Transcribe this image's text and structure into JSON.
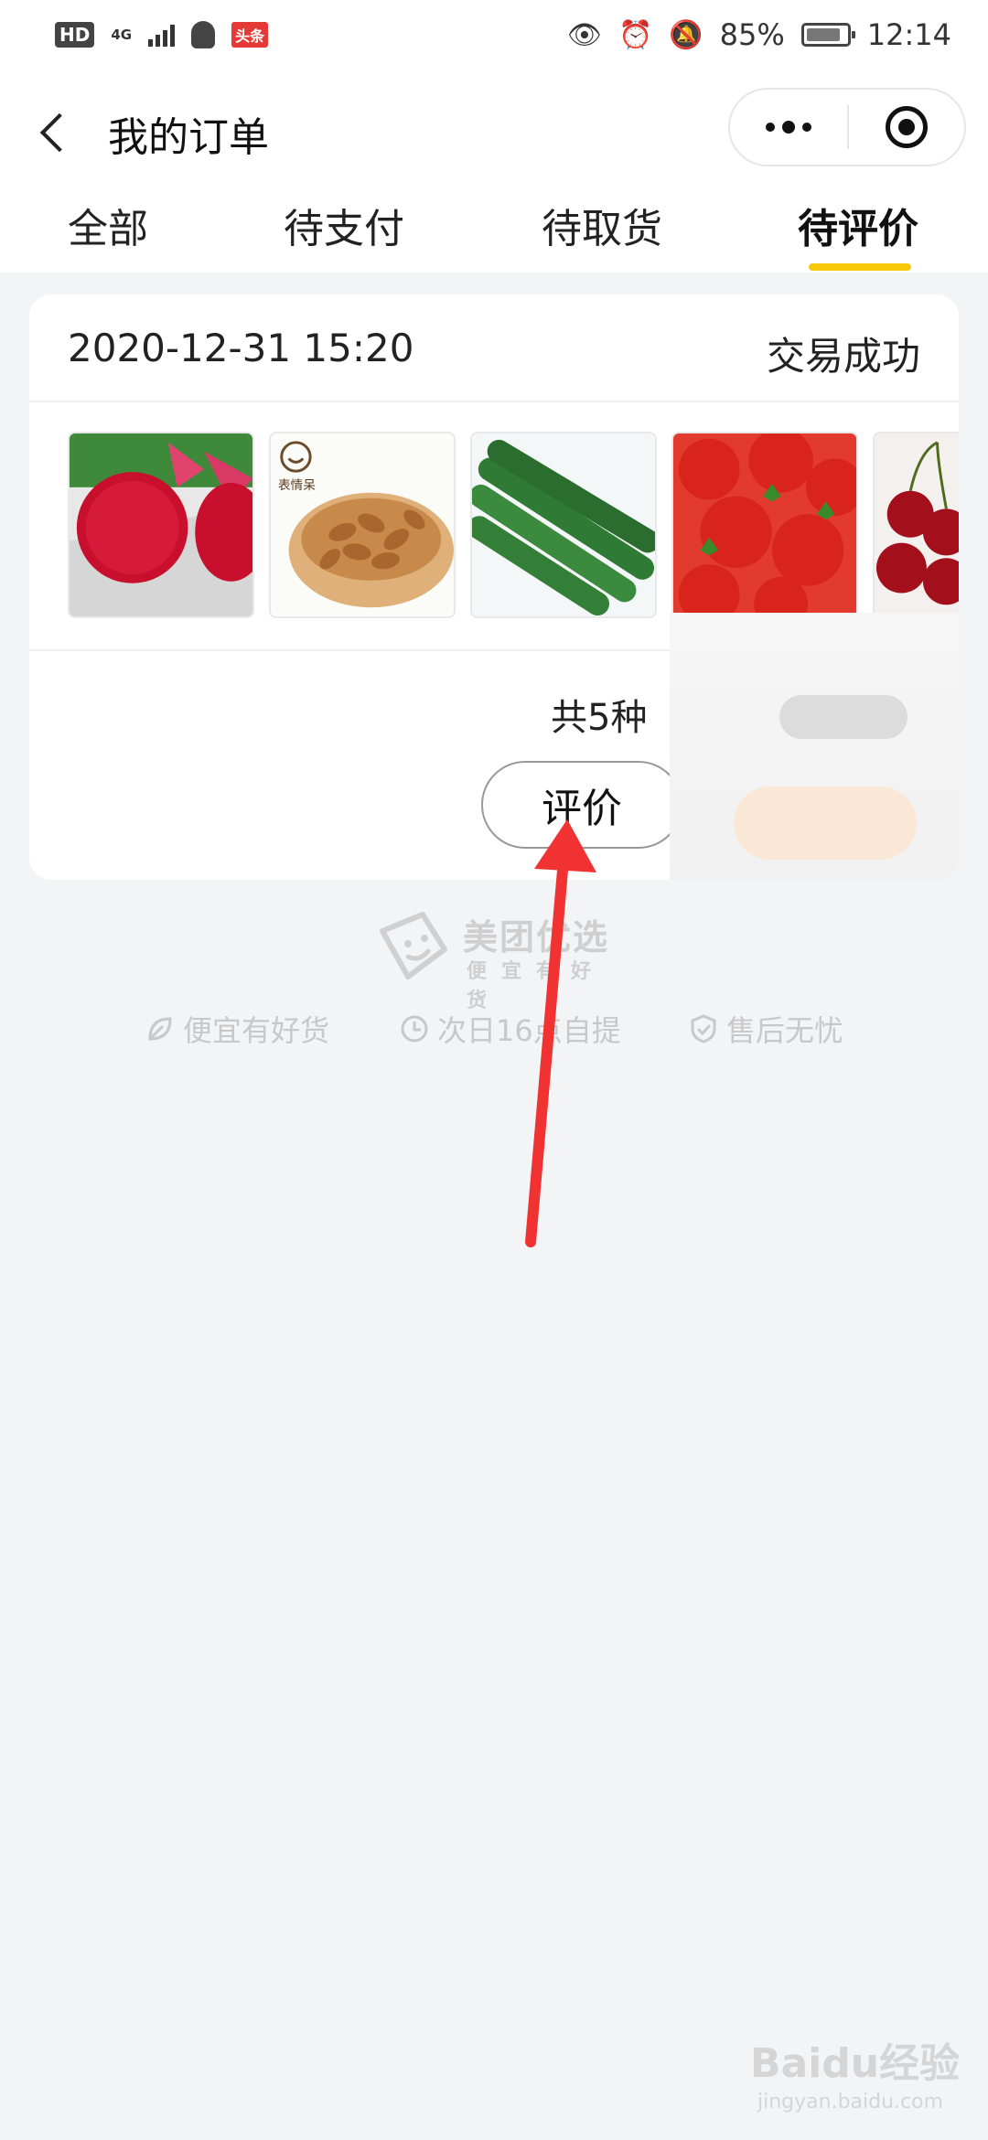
{
  "status_bar": {
    "hd": "HD",
    "network": "4G",
    "app_badge": "头条",
    "battery": "85%",
    "time": "12:14"
  },
  "nav": {
    "title": "我的订单"
  },
  "tabs": [
    {
      "label": "全部",
      "active": false
    },
    {
      "label": "待支付",
      "active": false
    },
    {
      "label": "待取货",
      "active": false
    },
    {
      "label": "待评价",
      "active": true
    }
  ],
  "order": {
    "time": "2020-12-31 15:20",
    "status": "交易成功",
    "products": [
      {
        "name": "dragon-fruit"
      },
      {
        "name": "almonds",
        "brand_text": "表情呆"
      },
      {
        "name": "cucumbers"
      },
      {
        "name": "strawberries"
      },
      {
        "name": "cherries"
      }
    ],
    "count_text": "共5种",
    "review_button": "评价"
  },
  "brand": {
    "name": "美团优选",
    "slogan": "便宜有好货"
  },
  "features": [
    {
      "label": "便宜有好货",
      "icon": "leaf-icon"
    },
    {
      "label": "次日16点自提",
      "icon": "clock-icon"
    },
    {
      "label": "售后无忧",
      "icon": "shield-check-icon"
    }
  ],
  "watermark": {
    "text": "Baidu经验",
    "sub": "jingyan.baidu.com"
  },
  "colors": {
    "accent": "#f7c70a",
    "background": "#f3f4f6",
    "arrow": "#f03232"
  }
}
